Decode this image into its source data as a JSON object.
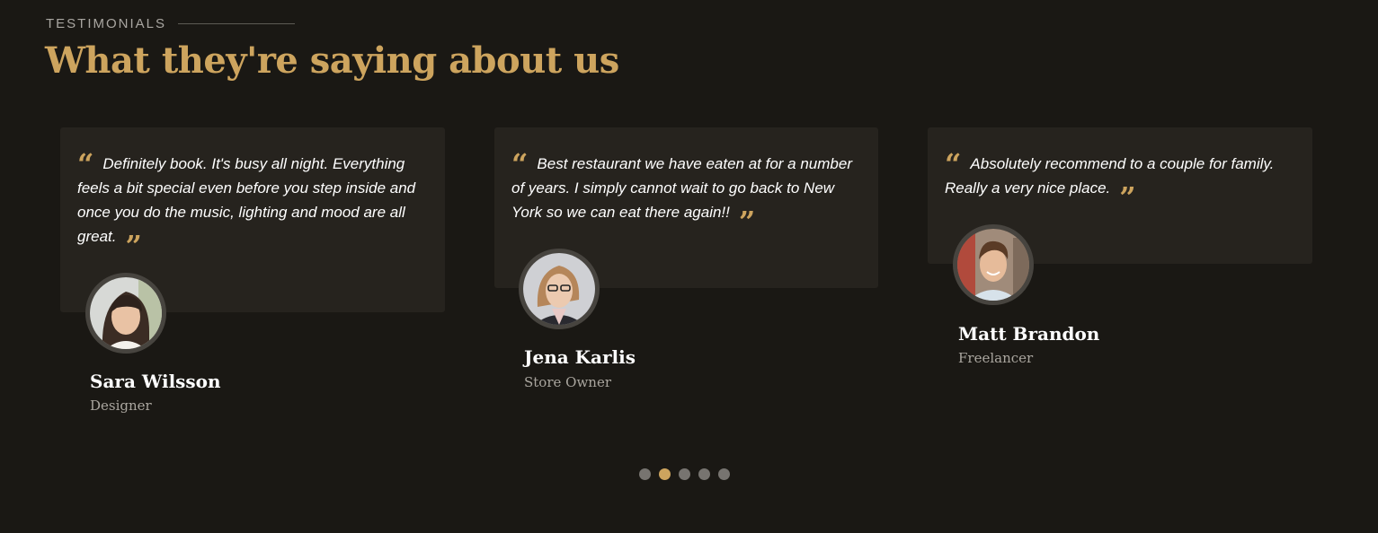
{
  "section": {
    "tag": "TESTIMONIALS",
    "title": "What they're saying about us"
  },
  "quote_marks": {
    "open": "“",
    "close": "”"
  },
  "testimonials": [
    {
      "quote": "Definitely book. It's busy all night. Everything feels a bit special even before you step inside and once you do the music, lighting and mood are all great.",
      "name": "Sara Wilsson",
      "role": "Designer"
    },
    {
      "quote": "Best restaurant we have eaten at for a number of years. I simply cannot wait to go back to New York so we can eat there again!!",
      "name": "Jena Karlis",
      "role": "Store Owner"
    },
    {
      "quote": "Absolutely recommend to a couple for family. Really a very nice place.",
      "name": "Matt Brandon",
      "role": "Freelancer"
    }
  ],
  "pagination": {
    "count": 5,
    "active": 2
  },
  "colors": {
    "accent": "#cda45e",
    "background": "#1a1814",
    "card": "#26231e",
    "avatar_ring": "#47443f",
    "dot_inactive": "#777470"
  }
}
